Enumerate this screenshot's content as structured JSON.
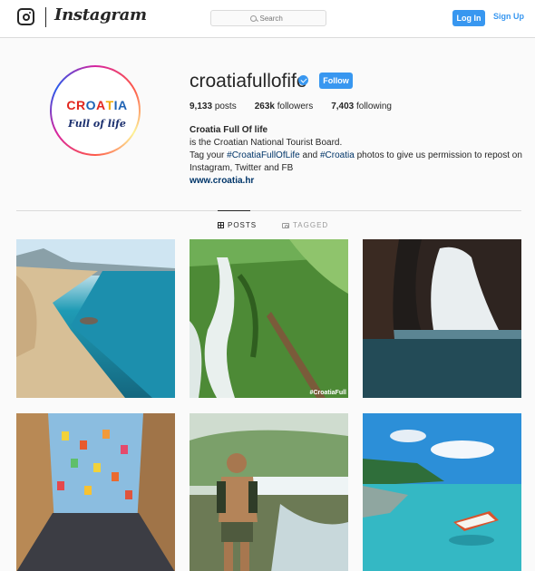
{
  "nav": {
    "wordmark": "Instagram",
    "search_placeholder": "Search",
    "login_label": "Log In",
    "signup_label": "Sign Up"
  },
  "profile": {
    "username": "croatiafullofife",
    "follow_label": "Follow",
    "avatar_logo_top": "CROATIA",
    "avatar_logo_bottom": "Full of life",
    "stats": {
      "posts_count": "9,133",
      "posts_label": "posts",
      "followers_count": "263k",
      "followers_label": "followers",
      "following_count": "7,403",
      "following_label": "following"
    },
    "bio": {
      "name": "Croatia Full Of life",
      "line1": "is the Croatian National Tourist Board.",
      "line2_a": "Tag your ",
      "line2_tag1": "#CroatiaFullOfLife",
      "line2_b": " and ",
      "line2_tag2": "#Croatia",
      "line2_c": " photos to give us permission to repost on",
      "line3": "Instagram, Twitter and FB",
      "link": "www.croatia.hr"
    }
  },
  "tabs": {
    "posts": "POSTS",
    "tagged": "TAGGED"
  },
  "photos": {
    "watermark": "#CroatiaFull"
  },
  "colors": {
    "accent": "#3897f0",
    "hashtag": "#003569"
  }
}
